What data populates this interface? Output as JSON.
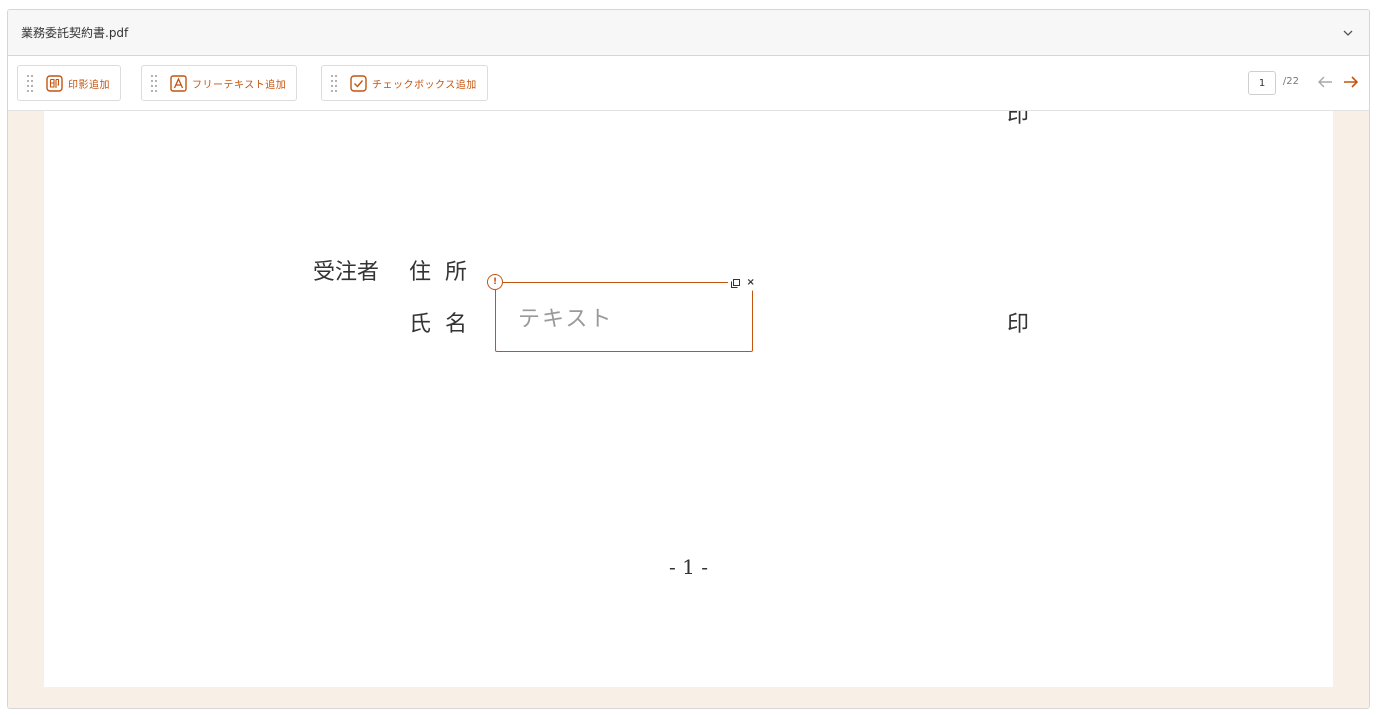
{
  "file": {
    "name": "業務委託契約書.pdf"
  },
  "toolbar": {
    "buttons": [
      {
        "label": "印影追加",
        "icon": "seal-icon"
      },
      {
        "label": "フリーテキスト追加",
        "icon": "text-a-icon"
      },
      {
        "label": "チェックボックス追加",
        "icon": "checkbox-icon"
      }
    ],
    "pagination": {
      "current_page": "1",
      "total_pages": "/22"
    }
  },
  "document": {
    "partial_seal_text": "印",
    "contractor_label": "受注者",
    "address_label": "住所",
    "name_label": "氏名",
    "seal_mark": "印",
    "page_number": "- 1 -"
  },
  "text_field": {
    "placeholder": "テキスト",
    "warning_glyph": "!",
    "close_glyph": "×"
  },
  "colors": {
    "accent": "#c4540e",
    "viewer_background": "#f8f0e6",
    "border": "#d6d6d6"
  }
}
